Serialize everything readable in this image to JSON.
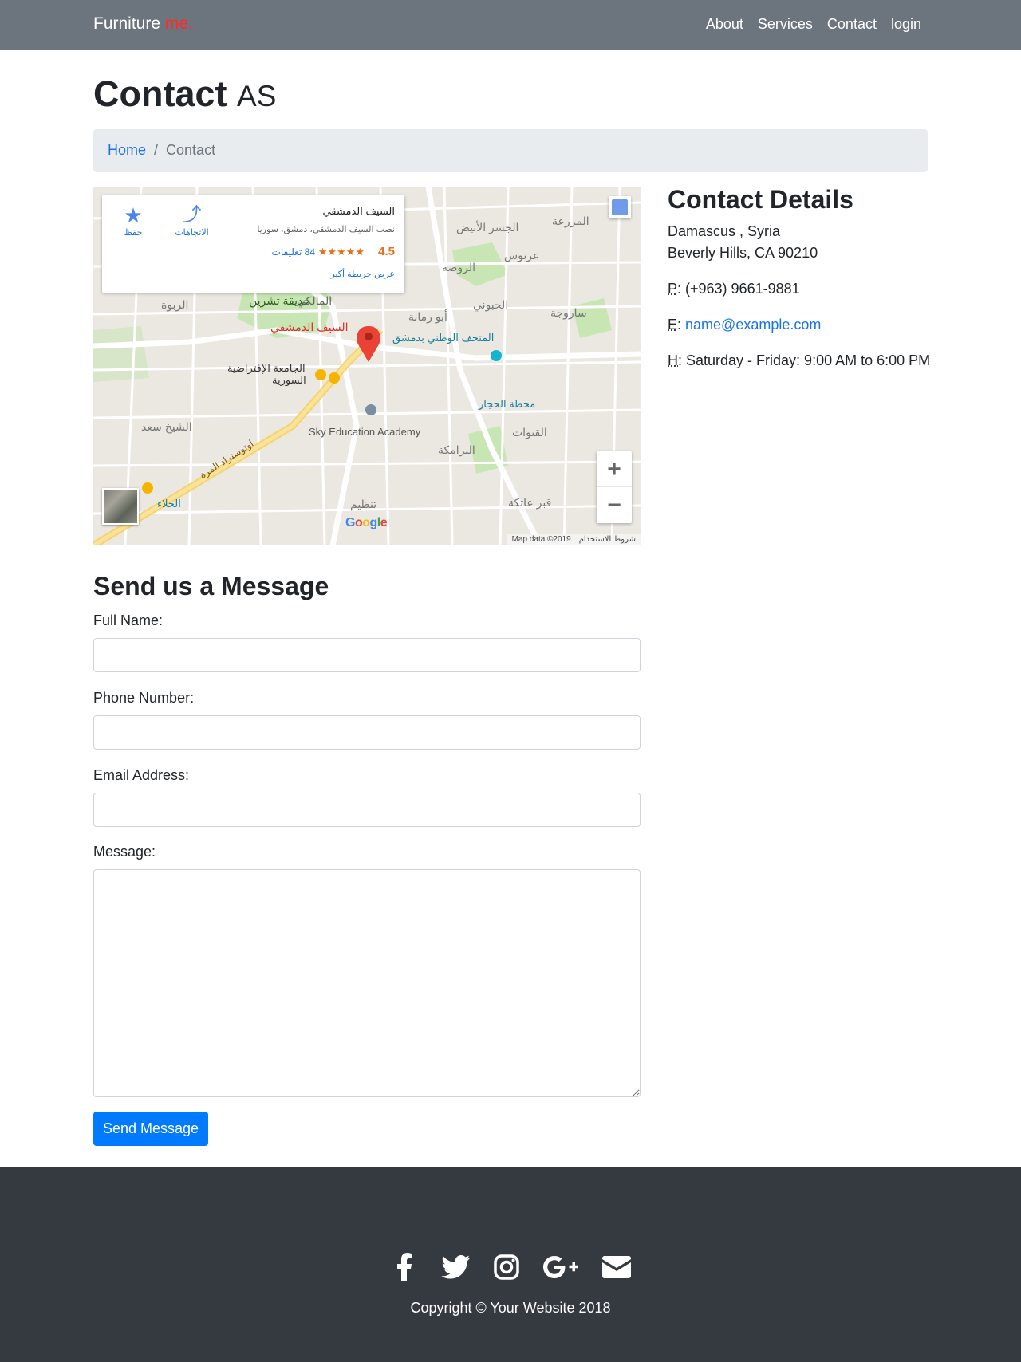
{
  "nav": {
    "brand_main": "Furniture",
    "brand_accent": "me.",
    "links": [
      "About",
      "Services",
      "Contact",
      "login"
    ]
  },
  "page": {
    "title": "Contact",
    "subtitle": "AS"
  },
  "breadcrumb": {
    "home": "Home",
    "separator": "/",
    "current": "Contact"
  },
  "map": {
    "place_name": "السيف الدمشقي",
    "place_address": "نصب السيف الدمشقي، دمشق، سوريا",
    "rating": "4.5",
    "stars": "★★★★★",
    "reviews": "84 تعليقات",
    "larger_map": "عرض خريطة أكبر",
    "save_label": "حفظ",
    "directions_label": "الاتجاهات",
    "zoom_in": "+",
    "zoom_out": "−",
    "attribution": "Map data ©2019",
    "terms": "شروط الاستخدام",
    "google": "Google",
    "labels": {
      "marker": "السيف الدمشقي",
      "park": "حديقة تشرين",
      "museum": "المتحف الوطني بدمشق",
      "university_1": "الجامعة الإفتراضية",
      "university_2": "السورية",
      "academy": "Sky Education Academy",
      "station": "محطة الحجاز",
      "malki": "المالكي",
      "rawda": "الروضة",
      "rabweh": "الربوة",
      "sheikh_saad": "الشيخ سعد",
      "baramkeh": "البرامكة",
      "halbouni": "الحبوني",
      "sarouja": "ساروجة",
      "mezzeh_highway": "اوتوستراد المزة",
      "jisr": "الجسر الأبيض",
      "arnous": "عرنوس",
      "mazraa": "المزرعة",
      "abu_rummaneh": "أبو رمانة",
      "hilla": "الحلاء",
      "qanawat": "القنوات",
      "qasr": "قبر عاتكة",
      "tanzim": "تنظيم"
    }
  },
  "contact": {
    "heading": "Contact Details",
    "address_1": "Damascus , Syria",
    "address_2": "Beverly Hills, CA 90210",
    "phone_abbr": "P",
    "phone": ": (+963) 9661-9881",
    "email_abbr": "E",
    "email_sep": ": ",
    "email": "name@example.com",
    "hours_abbr": "H",
    "hours": ": Saturday - Friday: 9:00 AM to 6:00 PM"
  },
  "form": {
    "title": "Send us a Message",
    "full_name_label": "Full Name:",
    "phone_label": "Phone Number:",
    "email_label": "Email Address:",
    "message_label": "Message:",
    "full_name_value": "",
    "phone_value": "",
    "email_value": "",
    "message_value": "",
    "submit": "Send Message"
  },
  "footer": {
    "social_icons": [
      "facebook-icon",
      "twitter-icon",
      "instagram-icon",
      "google-plus-icon",
      "envelope-icon"
    ],
    "copyright": "Copyright © Your Website 2018"
  },
  "colors": {
    "navbar": "#6c757d",
    "brand_accent": "#ff2a2a",
    "primary": "#007bff",
    "link": "#1a73e8",
    "footer": "#343a40",
    "breadcrumb_bg": "#e9ecef",
    "map_marker": "#ea4335"
  }
}
